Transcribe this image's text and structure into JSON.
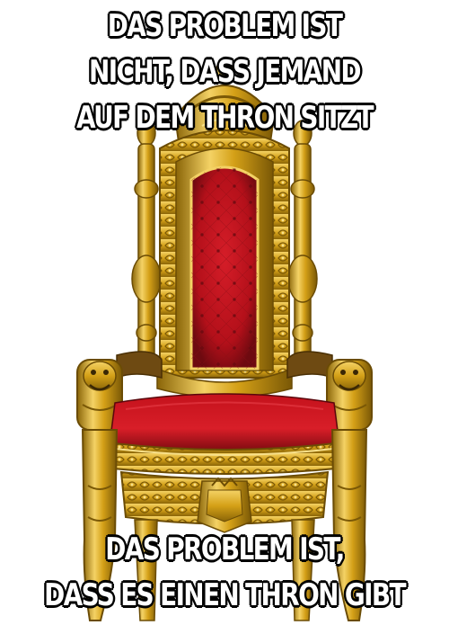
{
  "meme": {
    "top_text": "DAS PROBLEM IST\nNICHT, DASS JEMAND\nAUF DEM THRON SITZT",
    "bottom_text": "DAS PROBLEM IST,\nDASS ES EINEN THRON GIBT"
  },
  "image": {
    "subject": "throne-illustration",
    "colors": {
      "gold": "#d4a017",
      "gold_dark": "#8a6508",
      "gold_light": "#f4d265",
      "velvet": "#b4101a",
      "velvet_dark": "#6e0a10",
      "background": "#ffffff"
    }
  }
}
